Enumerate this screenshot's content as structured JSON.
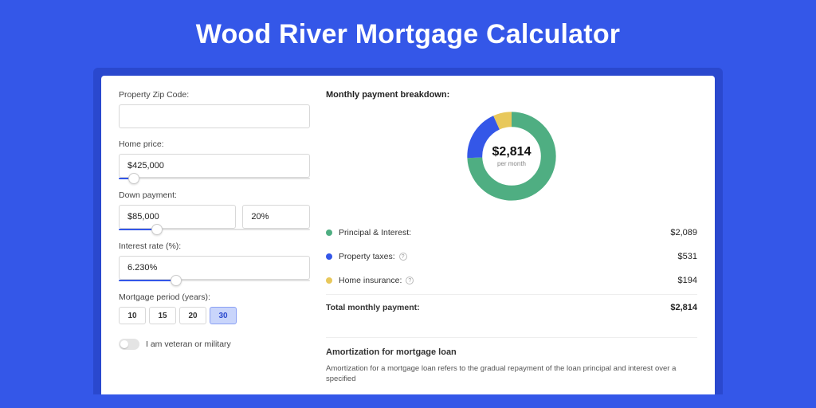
{
  "title": "Wood River Mortgage Calculator",
  "form": {
    "zip_label": "Property Zip Code:",
    "zip_value": "",
    "home_price_label": "Home price:",
    "home_price_value": "$425,000",
    "home_price_slider_pct": 8,
    "down_payment_label": "Down payment:",
    "down_payment_value": "$85,000",
    "down_payment_pct_value": "20%",
    "down_payment_slider_pct": 20,
    "interest_label": "Interest rate (%):",
    "interest_value": "6.230%",
    "interest_slider_pct": 30,
    "period_label": "Mortgage period (years):",
    "period_options": [
      "10",
      "15",
      "20",
      "30"
    ],
    "period_active": "30",
    "veteran_label": "I am veteran or military"
  },
  "breakdown": {
    "title": "Monthly payment breakdown:",
    "center_amount": "$2,814",
    "center_sub": "per month",
    "rows": [
      {
        "label": "Principal & Interest:",
        "value": "$2,089",
        "color": "green",
        "info": false
      },
      {
        "label": "Property taxes:",
        "value": "$531",
        "color": "blue",
        "info": true
      },
      {
        "label": "Home insurance:",
        "value": "$194",
        "color": "gold",
        "info": true
      }
    ],
    "total_label": "Total monthly payment:",
    "total_value": "$2,814"
  },
  "amortization": {
    "title": "Amortization for mortgage loan",
    "body": "Amortization for a mortgage loan refers to the gradual repayment of the loan principal and interest over a specified"
  },
  "chart_data": {
    "type": "pie",
    "title": "Monthly payment breakdown",
    "series": [
      {
        "name": "Principal & Interest",
        "value": 2089,
        "color": "#4fae82"
      },
      {
        "name": "Property taxes",
        "value": 531,
        "color": "#3457e8"
      },
      {
        "name": "Home insurance",
        "value": 194,
        "color": "#e8c85b"
      }
    ],
    "total": 2814,
    "center_label": "$2,814 per month"
  }
}
